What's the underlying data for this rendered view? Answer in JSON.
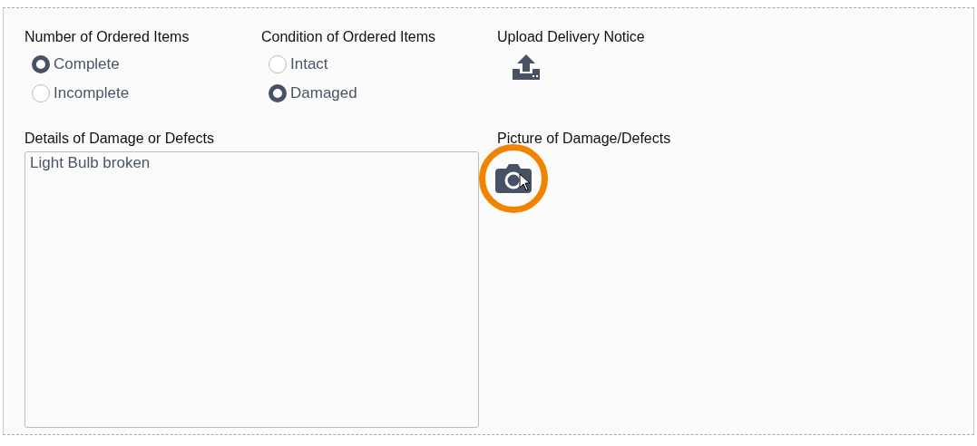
{
  "groups": [
    {
      "label": "Number of Ordered Items",
      "options": [
        {
          "label": "Complete",
          "selected": true
        },
        {
          "label": "Incomplete",
          "selected": false
        }
      ]
    },
    {
      "label": "Condition of Ordered Items",
      "options": [
        {
          "label": "Intact",
          "selected": false
        },
        {
          "label": "Damaged",
          "selected": true
        }
      ]
    }
  ],
  "upload": {
    "label": "Upload Delivery Notice"
  },
  "details": {
    "label": "Details of Damage or Defects",
    "value": "Light Bulb broken"
  },
  "picture": {
    "label": "Picture of Damage/Defects",
    "highlighted": true
  }
}
